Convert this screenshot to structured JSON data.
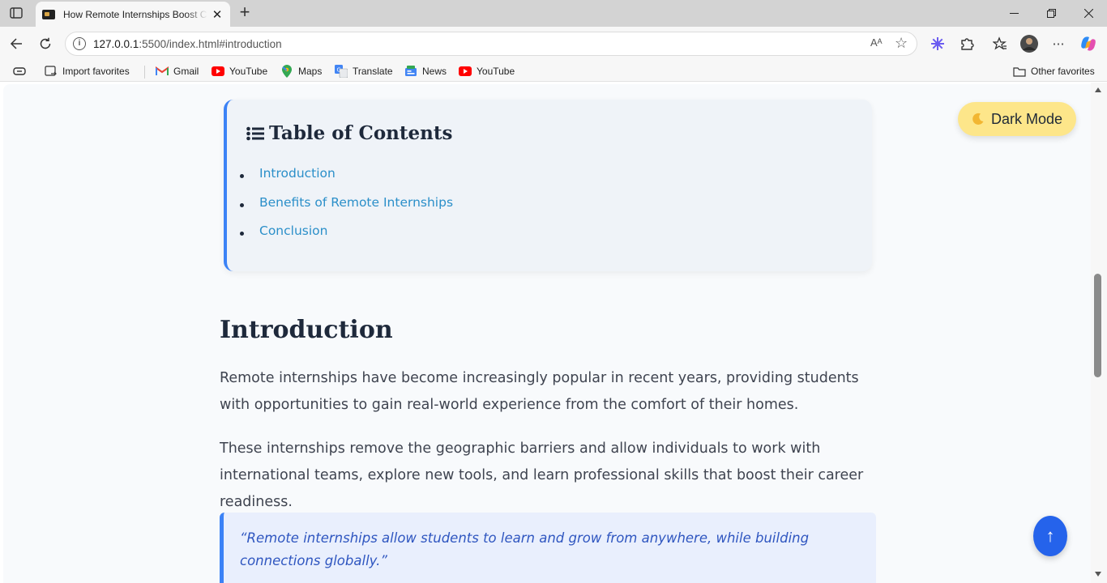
{
  "browser": {
    "tab_title": "How Remote Internships Boost Ca",
    "address_host": "127.0.0.1",
    "address_path": ":5500/index.html#introduction",
    "read_aloud_label": "Aᴬ",
    "favorites": [
      {
        "label": "Import favorites",
        "icon": "import-icon"
      },
      {
        "label": "Gmail",
        "icon": "gmail-icon"
      },
      {
        "label": "YouTube",
        "icon": "youtube-icon"
      },
      {
        "label": "Maps",
        "icon": "maps-icon"
      },
      {
        "label": "Translate",
        "icon": "translate-icon"
      },
      {
        "label": "News",
        "icon": "news-icon"
      },
      {
        "label": "YouTube",
        "icon": "youtube-icon"
      }
    ],
    "other_favorites": "Other favorites"
  },
  "page": {
    "toc": {
      "title": "Table of Contents",
      "items": [
        "Introduction",
        "Benefits of Remote Internships",
        "Conclusion"
      ]
    },
    "intro": {
      "heading": "Introduction",
      "p1": "Remote internships have become increasingly popular in recent years, providing students with opportunities to gain real-world experience from the comfort of their homes.",
      "p2": "These internships remove the geographic barriers and allow individuals to work with international teams, explore new tools, and learn professional skills that boost their career readiness.",
      "quote": "“Remote internships allow students to learn and grow from anywhere, while building connections globally.”"
    },
    "dark_mode_label": "Dark Mode",
    "back_to_top_label": "↑"
  },
  "colors": {
    "accent": "#3b82f6",
    "link": "#2b8fc9",
    "dark_mode_button": "#fde68a",
    "back_to_top": "#2563eb"
  }
}
